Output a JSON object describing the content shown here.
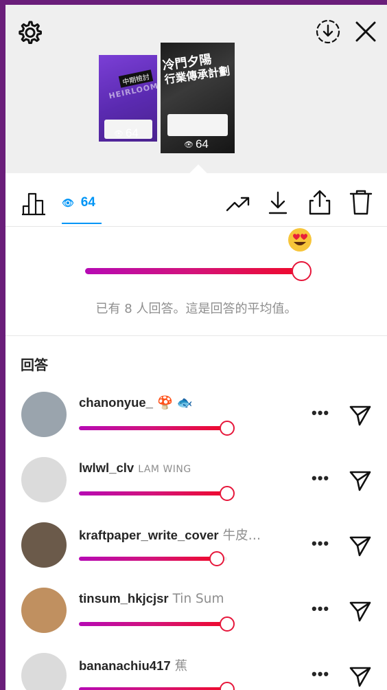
{
  "stories": [
    {
      "tag": "中期檢討",
      "watermark": "HEIRLOOM",
      "views": "64"
    },
    {
      "title_line1": "冷門夕陽",
      "title_line2": "行業傳承計劃",
      "views": "64"
    }
  ],
  "toolbar": {
    "views_count": "64"
  },
  "slider": {
    "emoji": "heart-eyes",
    "average": 1.0,
    "info_text": "已有 8 人回答。這是回答的平均值。"
  },
  "responses": {
    "heading": "回答",
    "items": [
      {
        "username": "chanonyue_",
        "subtitle": "🍄 🐟",
        "value": 1.0,
        "avatar_color": "#9aa4ad"
      },
      {
        "username": "lwlwl_clv",
        "subtitle": "LAM WING",
        "value": 1.0,
        "avatar_color": "#dbdbdb"
      },
      {
        "username": "kraftpaper_write_cover",
        "subtitle": "牛皮…",
        "value": 0.93,
        "avatar_color": "#6b5a4a"
      },
      {
        "username": "tinsum_hkjcjsr",
        "subtitle": "Tin Sum",
        "value": 1.0,
        "avatar_color": "#c09060"
      },
      {
        "username": "bananachiu417",
        "subtitle": "蕉",
        "value": 1.0,
        "avatar_color": "#dbdbdb"
      }
    ]
  },
  "colors": {
    "accent": "#0095f6",
    "slider_start": "#b60ab4",
    "slider_end": "#f00a2a",
    "frame": "#6a1e7a"
  }
}
